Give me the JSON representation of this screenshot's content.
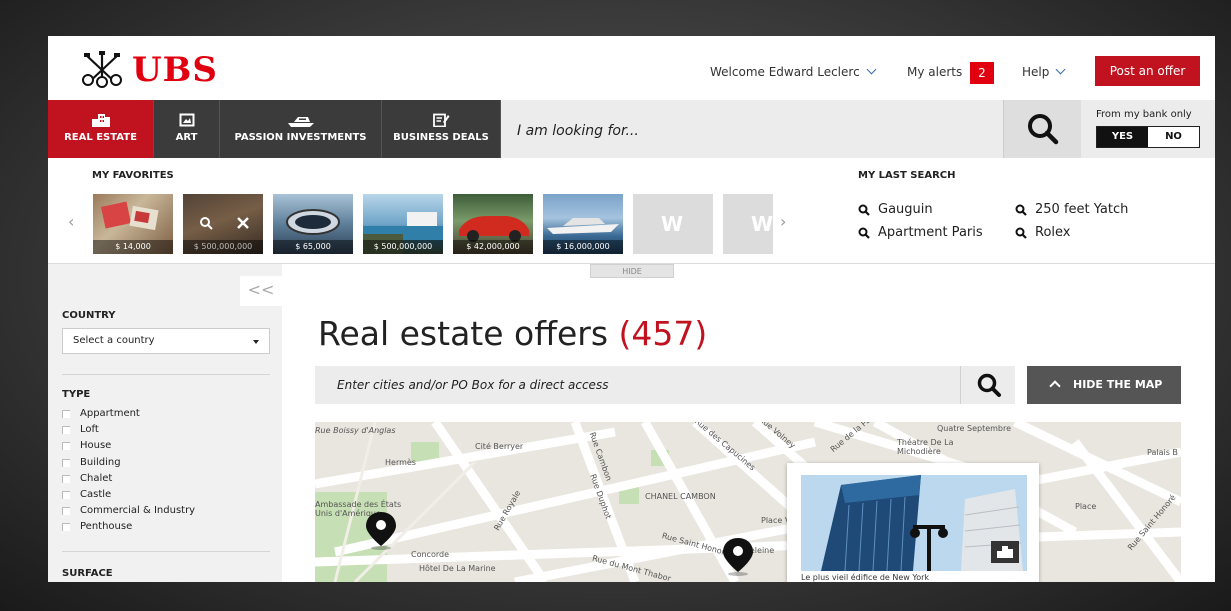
{
  "header": {
    "brand": "UBS",
    "welcome": "Welcome Edward Leclerc",
    "alerts_label": "My alerts",
    "alerts_count": "2",
    "help": "Help",
    "post_offer": "Post an offer"
  },
  "nav": {
    "tabs": [
      {
        "label": "REAL ESTATE",
        "icon": "building-icon",
        "active": true
      },
      {
        "label": "ART",
        "icon": "picture-frame-icon",
        "active": false
      },
      {
        "label": "PASSION INVESTMENTS",
        "icon": "yacht-icon",
        "active": false
      },
      {
        "label": "BUSINESS DEALS",
        "icon": "document-edit-icon",
        "active": false
      }
    ],
    "search_placeholder": "I am looking for...",
    "bank_only_label": "From my bank only",
    "toggle_yes": "YES",
    "toggle_no": "NO",
    "toggle_selected": "YES"
  },
  "favorites": {
    "title": "MY FAVORITES",
    "items": [
      {
        "price": "$ 14,000"
      },
      {
        "price": "$ 500,000,000"
      },
      {
        "price": "$ 65,000"
      },
      {
        "price": "$ 500,000,000"
      },
      {
        "price": "$ 42,000,000"
      },
      {
        "price": "$ 16,000,000"
      },
      {
        "placeholder": "W"
      },
      {
        "placeholder": "W"
      }
    ]
  },
  "last_search": {
    "title": "MY LAST SEARCH",
    "items": [
      "Gauguin",
      "250 feet Yatch",
      "Apartment Paris",
      "Rolex"
    ]
  },
  "hide_label": "HIDE",
  "sidebar": {
    "collapse_label": "<<",
    "country_title": "COUNTRY",
    "country_select": "Select a country",
    "type_title": "TYPE",
    "types": [
      "Appartment",
      "Loft",
      "House",
      "Building",
      "Chalet",
      "Castle",
      "Commercial & Industry",
      "Penthouse"
    ],
    "surface_title": "SURFACE"
  },
  "main": {
    "title": "Real estate offers",
    "count": "(457)",
    "city_search_placeholder": "Enter cities and/or PO Box for a direct access",
    "hide_map": "HIDE THE MAP"
  },
  "map": {
    "labels": [
      "Quatre Septembre",
      "Théatre De La Michodière",
      "Palais B",
      "Hermès",
      "Cité Berryer",
      "Rue Cambon",
      "Rue des Capucines",
      "Rue Volney",
      "Rue de la Paix",
      "Rue Royale",
      "Rue Duphot",
      "CHANEL CAMBON",
      "Place Vendôme",
      "Rue Saint Honoré",
      "Ambassade des États Unis d'Amérique",
      "Concorde",
      "Hôtel De La Marine",
      "Rue du Mont Thabor",
      "Madeleine",
      "Rue Boissy d'Anglas",
      "Rue Saint Honoré",
      "Place"
    ],
    "popup_caption": "Le plus vieil édifice de New York"
  }
}
